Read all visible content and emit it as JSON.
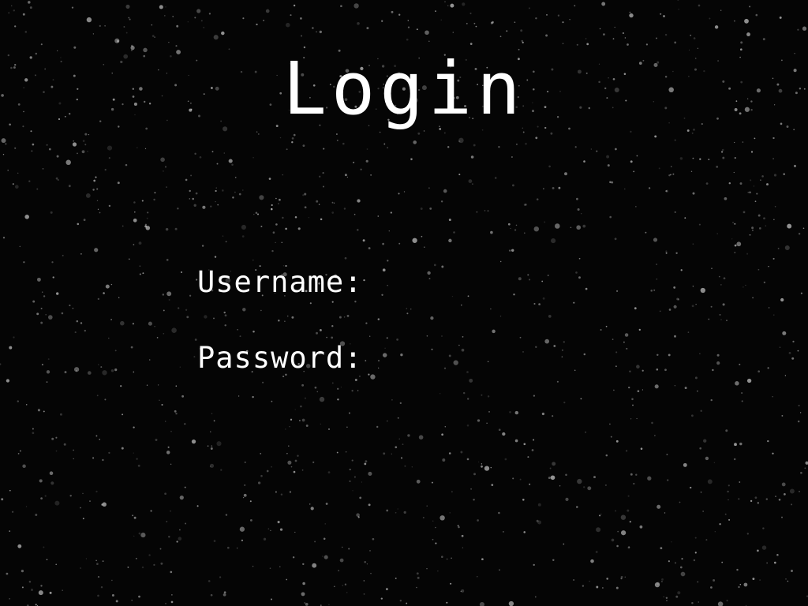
{
  "screen": {
    "title": "Login",
    "background_color": "#050505",
    "text_color": "#ffffff"
  },
  "form": {
    "username_label": "Username:",
    "username_value": "",
    "password_label": "Password:",
    "password_value": ""
  }
}
